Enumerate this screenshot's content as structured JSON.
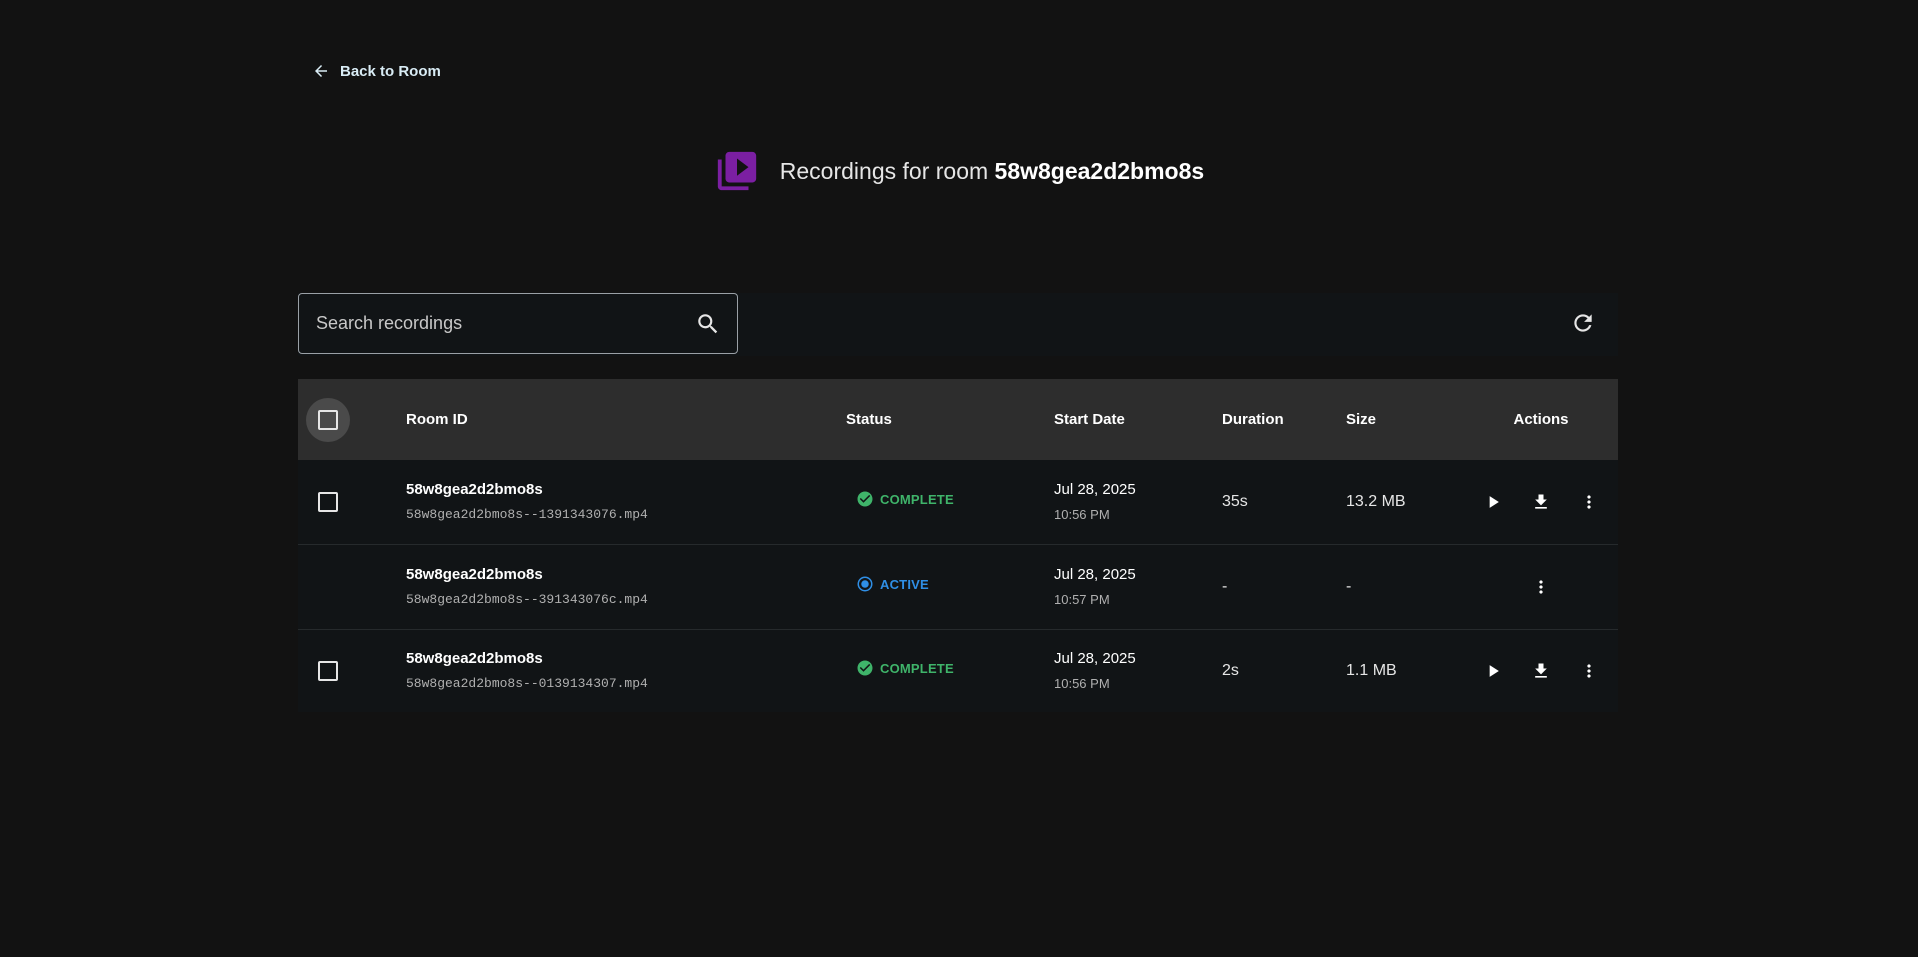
{
  "nav": {
    "back_label": "Back to Room"
  },
  "header": {
    "prefix": "Recordings for room",
    "room": "58w8gea2d2bmo8s",
    "icon": "video-library-icon",
    "icon_color": "#7b1fa2"
  },
  "search": {
    "placeholder": "Search recordings",
    "value": ""
  },
  "table": {
    "columns": [
      "Room ID",
      "Status",
      "Start Date",
      "Duration",
      "Size",
      "Actions"
    ],
    "rows": [
      {
        "room_id": "58w8gea2d2bmo8s",
        "file": "58w8gea2d2bmo8s--1391343076.mp4",
        "status": "COMPLETE",
        "date": "Jul 28, 2025",
        "time": "10:56 PM",
        "duration": "35s",
        "size": "13.2 MB",
        "selectable": true
      },
      {
        "room_id": "58w8gea2d2bmo8s",
        "file": "58w8gea2d2bmo8s--391343076c.mp4",
        "status": "ACTIVE",
        "date": "Jul 28, 2025",
        "time": "10:57 PM",
        "duration": "-",
        "size": "-",
        "selectable": false
      },
      {
        "room_id": "58w8gea2d2bmo8s",
        "file": "58w8gea2d2bmo8s--0139134307.mp4",
        "status": "COMPLETE",
        "date": "Jul 28, 2025",
        "time": "10:56 PM",
        "duration": "2s",
        "size": "1.1 MB",
        "selectable": true
      }
    ]
  },
  "colors": {
    "complete": "#3fb46a",
    "active": "#2f8fe6",
    "background": "#121212"
  }
}
